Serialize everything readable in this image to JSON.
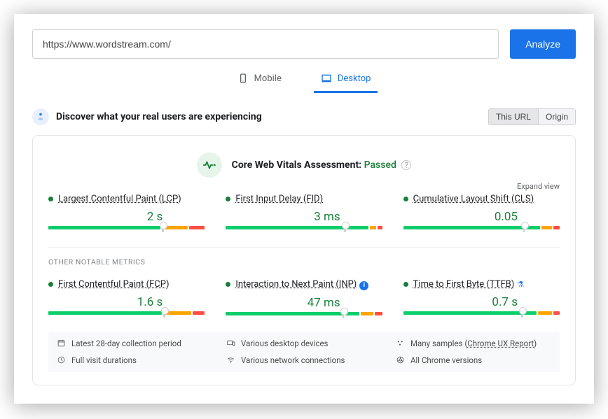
{
  "header": {
    "url_value": "https://www.wordstream.com/",
    "analyze_label": "Analyze",
    "tabs": {
      "mobile": "Mobile",
      "desktop": "Desktop"
    }
  },
  "discover": {
    "title": "Discover what your real users are experiencing",
    "toggle": {
      "this_url": "This URL",
      "origin": "Origin"
    }
  },
  "assessment": {
    "prefix": "Core Web Vitals Assessment: ",
    "result": "Passed",
    "expand": "Expand view"
  },
  "metrics": {
    "lcp": {
      "name": "Largest Contentful Paint (LCP)",
      "value": "2 s",
      "marker": 73,
      "segs": [
        73,
        17,
        10
      ]
    },
    "fid": {
      "name": "First Input Delay (FID)",
      "value": "3 ms",
      "marker": 76,
      "segs": [
        93,
        4,
        3
      ]
    },
    "cls": {
      "name": "Cumulative Layout Shift (CLS)",
      "value": "0.05",
      "marker": 77,
      "segs": [
        89,
        7,
        4
      ]
    },
    "fcp": {
      "name": "First Contentful Paint (FCP)",
      "value": "1.6 s",
      "marker": 74,
      "segs": [
        74,
        18,
        8
      ]
    },
    "inp": {
      "name": "Interaction to Next Paint (INP)",
      "value": "47 ms",
      "marker": 75,
      "segs": [
        87,
        8,
        5
      ]
    },
    "ttfb": {
      "name": "Time to First Byte (TTFB)",
      "value": "0.7 s",
      "marker": 76,
      "segs": [
        87,
        9,
        4
      ]
    }
  },
  "section_label": "OTHER NOTABLE METRICS",
  "footer": {
    "period": "Latest 28-day collection period",
    "devices": "Various desktop devices",
    "samples_pre": "Many samples (",
    "samples_link": "Chrome UX Report",
    "samples_post": ")",
    "visits": "Full visit durations",
    "network": "Various network connections",
    "versions": "All Chrome versions"
  }
}
